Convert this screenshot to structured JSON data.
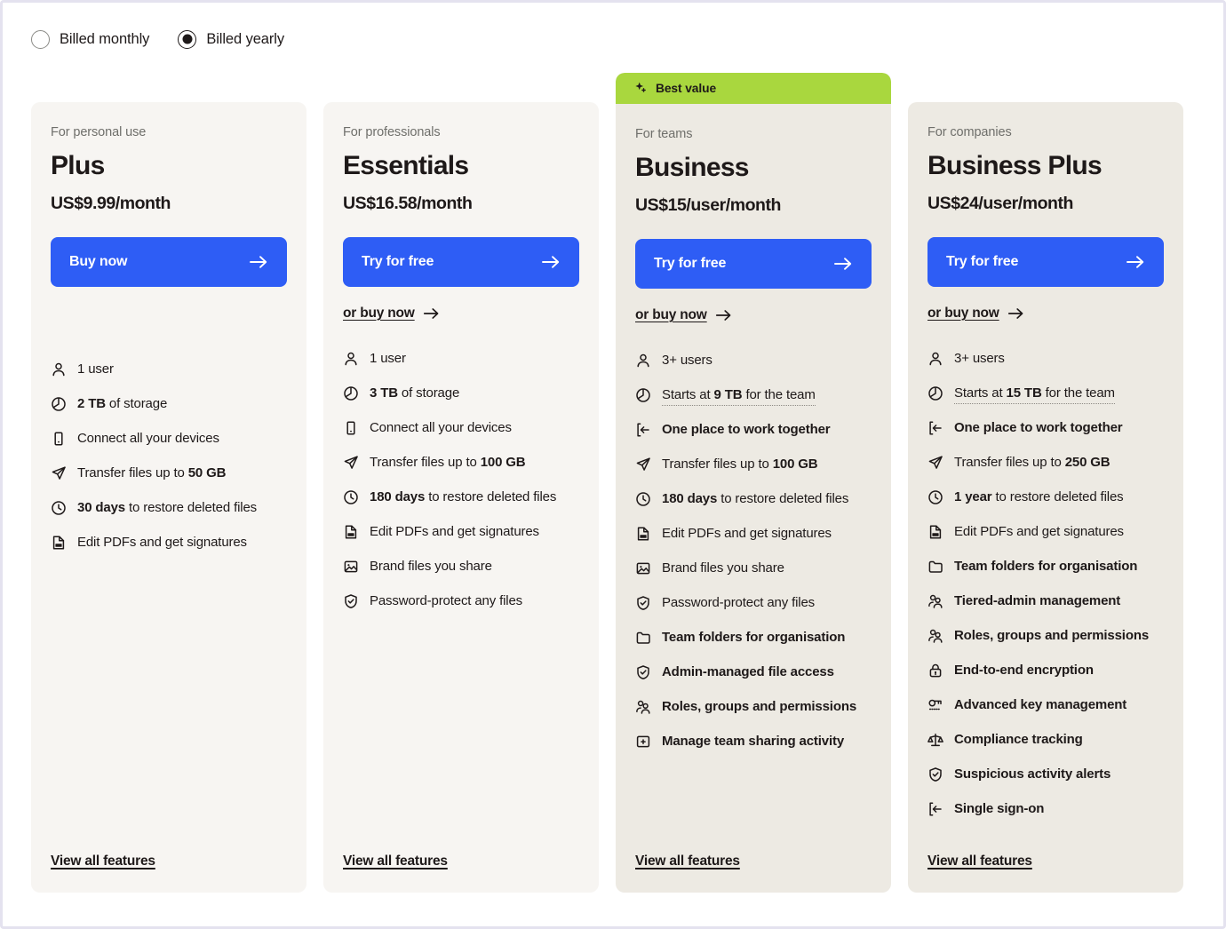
{
  "billing": {
    "options": [
      {
        "label": "Billed monthly",
        "selected": false
      },
      {
        "label": "Billed yearly",
        "selected": true
      }
    ]
  },
  "colors": {
    "cta_blue": "#2E5DF5",
    "badge_green": "#A9D73E",
    "card_light": "#F7F5F2",
    "card_warm": "#EDEAE3",
    "text": "#1E1919",
    "muted_text": "#6F6F6B",
    "page_frame": "#E4E2EF"
  },
  "plans": [
    {
      "badge": null,
      "eyebrow": "For personal use",
      "name": "Plus",
      "price": "US$9.99/month",
      "cta_label": "Buy now",
      "secondary_label": null,
      "view_all_label": "View all features",
      "tone": "light",
      "features": [
        {
          "icon": "user-icon",
          "text": "1 user",
          "bold_prefix": "",
          "bold_all": false,
          "tooltip": false
        },
        {
          "icon": "storage-icon",
          "text": " of storage",
          "bold_prefix": "2 TB",
          "bold_all": false,
          "tooltip": false
        },
        {
          "icon": "devices-icon",
          "text": "Connect all your devices",
          "bold_prefix": "",
          "bold_all": false,
          "tooltip": false
        },
        {
          "icon": "transfer-icon",
          "text": "Transfer files up to ",
          "bold_suffix": "50 GB",
          "bold_all": false,
          "tooltip": false
        },
        {
          "icon": "clock-icon",
          "text": " to restore deleted files",
          "bold_prefix": "30 days",
          "bold_all": false,
          "tooltip": false
        },
        {
          "icon": "pdf-icon",
          "text": "Edit PDFs and get signatures",
          "bold_prefix": "",
          "bold_all": false,
          "tooltip": false
        }
      ]
    },
    {
      "badge": null,
      "eyebrow": "For professionals",
      "name": "Essentials",
      "price": "US$16.58/month",
      "cta_label": "Try for free",
      "secondary_label": "or buy now",
      "view_all_label": "View all features",
      "tone": "light",
      "features": [
        {
          "icon": "user-icon",
          "text": "1 user",
          "bold_prefix": "",
          "bold_all": false,
          "tooltip": false
        },
        {
          "icon": "storage-icon",
          "text": " of storage",
          "bold_prefix": "3 TB",
          "bold_all": false,
          "tooltip": false
        },
        {
          "icon": "devices-icon",
          "text": "Connect all your devices",
          "bold_prefix": "",
          "bold_all": false,
          "tooltip": false
        },
        {
          "icon": "transfer-icon",
          "text": "Transfer files up to ",
          "bold_suffix": "100 GB",
          "bold_all": false,
          "tooltip": false
        },
        {
          "icon": "clock-icon",
          "text": " to restore deleted files",
          "bold_prefix": "180 days",
          "bold_all": false,
          "tooltip": false
        },
        {
          "icon": "pdf-icon",
          "text": "Edit PDFs and get signatures",
          "bold_prefix": "",
          "bold_all": false,
          "tooltip": false
        },
        {
          "icon": "brand-image-icon",
          "text": "Brand files you share",
          "bold_prefix": "",
          "bold_all": false,
          "tooltip": false
        },
        {
          "icon": "shield-check-icon",
          "text": "Password-protect any files",
          "bold_prefix": "",
          "bold_all": false,
          "tooltip": false
        }
      ]
    },
    {
      "badge": "Best value",
      "eyebrow": "For teams",
      "name": "Business",
      "price": "US$15/user/month",
      "cta_label": "Try for free",
      "secondary_label": "or buy now",
      "view_all_label": "View all features",
      "tone": "warm",
      "features": [
        {
          "icon": "user-icon",
          "text": "3+ users",
          "bold_prefix": "",
          "bold_all": false,
          "tooltip": false
        },
        {
          "icon": "storage-icon",
          "text": "Starts at ",
          "bold_suffix": "9 TB",
          "text_after": " for the team",
          "bold_all": false,
          "tooltip": true
        },
        {
          "icon": "login-icon",
          "text": "One place to work together",
          "bold_prefix": "",
          "bold_all": true,
          "tooltip": false
        },
        {
          "icon": "transfer-icon",
          "text": "Transfer files up to ",
          "bold_suffix": "100 GB",
          "bold_all": false,
          "tooltip": false
        },
        {
          "icon": "clock-icon",
          "text": " to restore deleted files",
          "bold_prefix": "180 days",
          "bold_all": false,
          "tooltip": false
        },
        {
          "icon": "pdf-icon",
          "text": "Edit PDFs and get signatures",
          "bold_prefix": "",
          "bold_all": false,
          "tooltip": false
        },
        {
          "icon": "brand-image-icon",
          "text": "Brand files you share",
          "bold_prefix": "",
          "bold_all": false,
          "tooltip": false
        },
        {
          "icon": "shield-check-icon",
          "text": "Password-protect any files",
          "bold_prefix": "",
          "bold_all": false,
          "tooltip": false
        },
        {
          "icon": "folder-icon",
          "text": "Team folders for organisation",
          "bold_prefix": "",
          "bold_all": true,
          "tooltip": false
        },
        {
          "icon": "shield-check-icon",
          "text": "Admin-managed file access",
          "bold_prefix": "",
          "bold_all": true,
          "tooltip": false
        },
        {
          "icon": "users-group-icon",
          "text": "Roles, groups and permissions",
          "bold_prefix": "",
          "bold_all": true,
          "tooltip": false
        },
        {
          "icon": "folder-add-icon",
          "text": "Manage team sharing activity",
          "bold_prefix": "",
          "bold_all": true,
          "tooltip": false
        }
      ]
    },
    {
      "badge": null,
      "eyebrow": "For companies",
      "name": "Business Plus",
      "price": "US$24/user/month",
      "cta_label": "Try for free",
      "secondary_label": "or buy now",
      "view_all_label": "View all features",
      "tone": "warm",
      "features": [
        {
          "icon": "user-icon",
          "text": "3+ users",
          "bold_prefix": "",
          "bold_all": false,
          "tooltip": false
        },
        {
          "icon": "storage-icon",
          "text": "Starts at ",
          "bold_suffix": "15 TB",
          "text_after": " for the team",
          "bold_all": false,
          "tooltip": true
        },
        {
          "icon": "login-icon",
          "text": "One place to work together",
          "bold_prefix": "",
          "bold_all": true,
          "tooltip": false
        },
        {
          "icon": "transfer-icon",
          "text": "Transfer files up to ",
          "bold_suffix": "250 GB",
          "bold_all": false,
          "tooltip": false
        },
        {
          "icon": "clock-icon",
          "text": " to restore deleted files",
          "bold_prefix": "1 year",
          "bold_all": false,
          "tooltip": false
        },
        {
          "icon": "pdf-icon",
          "text": "Edit PDFs and get signatures",
          "bold_prefix": "",
          "bold_all": false,
          "tooltip": false
        },
        {
          "icon": "folder-icon",
          "text": "Team folders for organisation",
          "bold_prefix": "",
          "bold_all": true,
          "tooltip": false
        },
        {
          "icon": "users-group-icon",
          "text": "Tiered-admin management",
          "bold_prefix": "",
          "bold_all": true,
          "tooltip": false
        },
        {
          "icon": "users-group-icon",
          "text": "Roles, groups and permissions",
          "bold_prefix": "",
          "bold_all": true,
          "tooltip": false
        },
        {
          "icon": "lock-icon",
          "text": "End-to-end encryption",
          "bold_prefix": "",
          "bold_all": true,
          "tooltip": false
        },
        {
          "icon": "key-icon",
          "text": "Advanced key management",
          "bold_prefix": "",
          "bold_all": true,
          "tooltip": false
        },
        {
          "icon": "scales-icon",
          "text": "Compliance tracking",
          "bold_prefix": "",
          "bold_all": true,
          "tooltip": false
        },
        {
          "icon": "shield-check-icon",
          "text": "Suspicious activity alerts",
          "bold_prefix": "",
          "bold_all": true,
          "tooltip": false
        },
        {
          "icon": "login-icon",
          "text": "Single sign-on",
          "bold_prefix": "",
          "bold_all": true,
          "tooltip": false
        }
      ]
    }
  ]
}
